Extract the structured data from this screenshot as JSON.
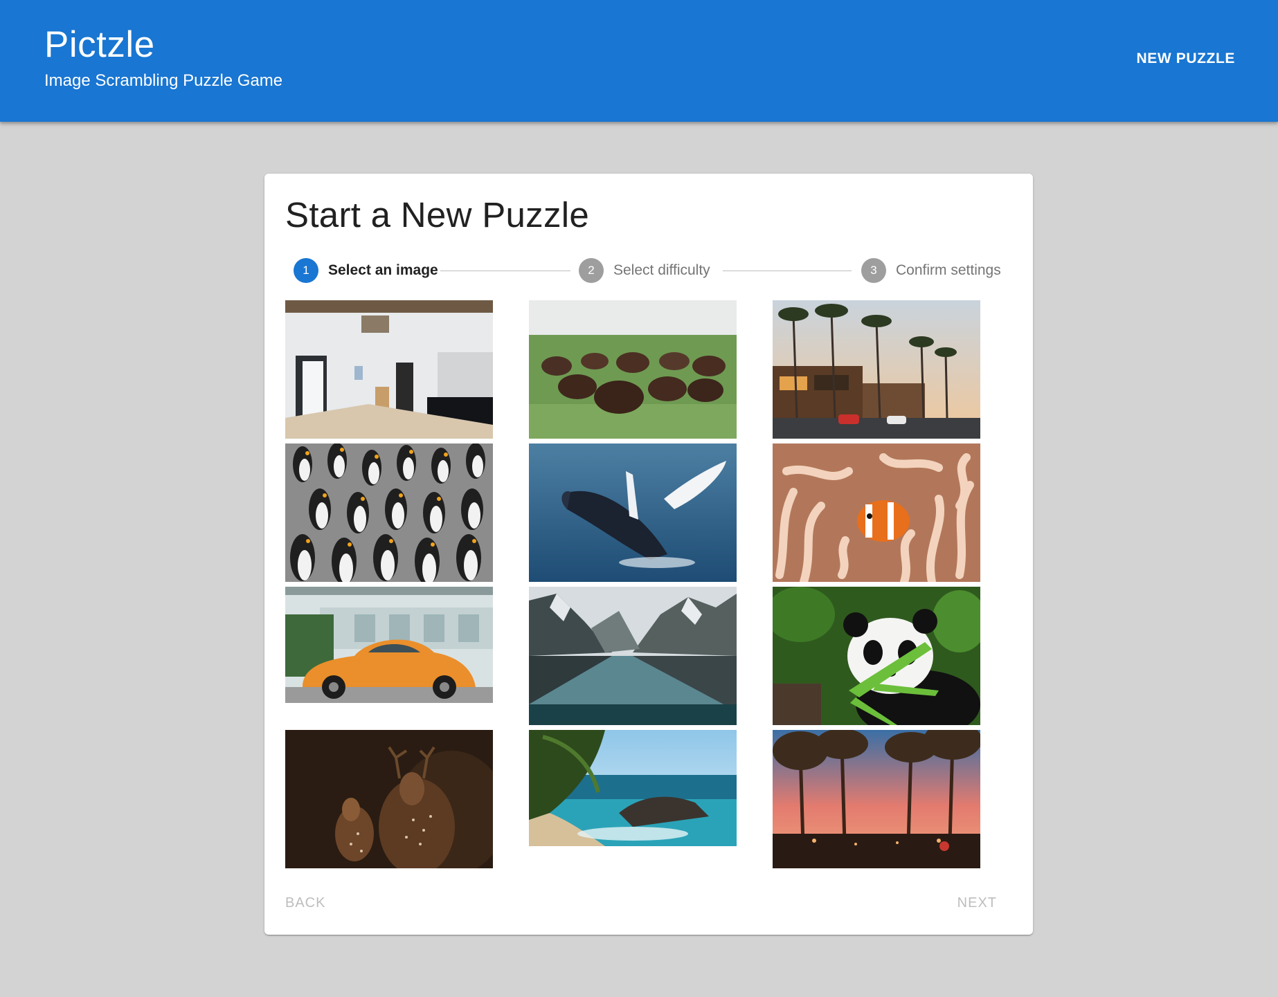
{
  "app": {
    "title": "Pictzle",
    "subtitle": "Image Scrambling Puzzle Game",
    "new_puzzle_label": "NEW PUZZLE",
    "color_primary": "#1976d2",
    "color_background": "#d3d3d3"
  },
  "card": {
    "heading": "Start a New Puzzle"
  },
  "stepper": {
    "active_step": 1,
    "steps": [
      {
        "number": "1",
        "label": "Select an image"
      },
      {
        "number": "2",
        "label": "Select difficulty"
      },
      {
        "number": "3",
        "label": "Confirm settings"
      }
    ]
  },
  "images": [
    {
      "name": "interior-room-image"
    },
    {
      "name": "bison-herd-image"
    },
    {
      "name": "beach-town-palms-image"
    },
    {
      "name": "penguin-colony-image"
    },
    {
      "name": "breaching-whale-image"
    },
    {
      "name": "clownfish-anemone-image"
    },
    {
      "name": "orange-beetle-car-image"
    },
    {
      "name": "mountain-lake-image"
    },
    {
      "name": "panda-bamboo-image"
    },
    {
      "name": "deer-family-image"
    },
    {
      "name": "coastal-cove-image"
    },
    {
      "name": "palm-street-sunset-image"
    }
  ],
  "actions": {
    "back_label": "BACK",
    "next_label": "NEXT"
  }
}
